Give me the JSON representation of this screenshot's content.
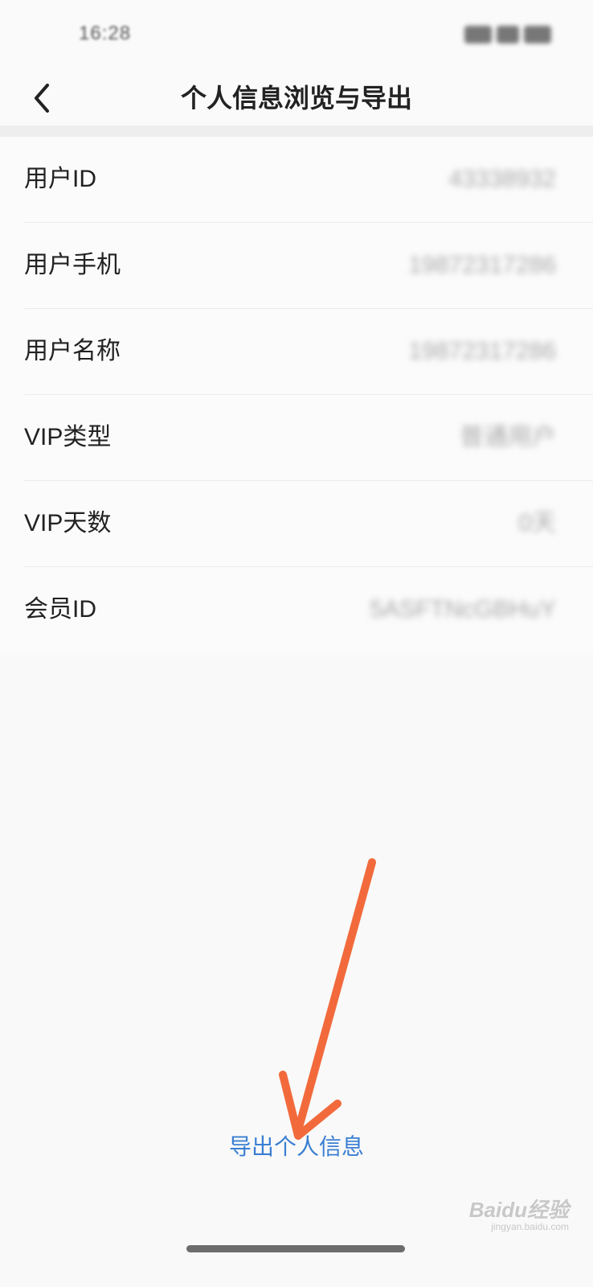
{
  "status_bar": {
    "time": "16:28"
  },
  "nav": {
    "title": "个人信息浏览与导出",
    "back_icon": "chevron-left-icon"
  },
  "info_rows": [
    {
      "label": "用户ID",
      "value": "43338932"
    },
    {
      "label": "用户手机",
      "value": "19872317286"
    },
    {
      "label": "用户名称",
      "value": "19872317286"
    },
    {
      "label": "VIP类型",
      "value": "普通用户"
    },
    {
      "label": "VIP天数",
      "value": "0天"
    },
    {
      "label": "会员ID",
      "value": "5ASFTNcGBHuY"
    }
  ],
  "export": {
    "label": "导出个人信息"
  },
  "annotation": {
    "color": "#f26a3c"
  },
  "watermark": {
    "text": "Baidu经验",
    "sub": "jingyan.baidu.com"
  },
  "colors": {
    "link": "#3a7fd2",
    "background": "#f9f9f9"
  }
}
